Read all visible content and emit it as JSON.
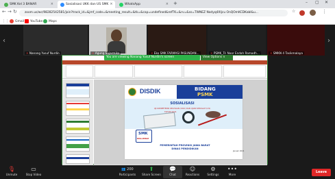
{
  "browser": {
    "tabs": [
      {
        "title": "SMK Kel 3 BANAR",
        "color": "#4caf50"
      },
      {
        "title": "Sosialisasi UKK dan US SMK",
        "color": "#2d8cff"
      },
      {
        "title": "WhatsApp",
        "color": "#25d366"
      }
    ],
    "url": "zoom.us/wc/98282542581/join?track_id=&jmf_code=&meeting_result=&tk=&cap=undefined&refTK=&rv=&ss=TWNEZ Nodyq4XIjcu OnQOmKCDKabl&u...",
    "bookmarks": [
      {
        "label": "Gmail",
        "color": "#ea4335"
      },
      {
        "label": "YouTube",
        "color": "#ff0000"
      },
      {
        "label": "Maps",
        "color": "#34a853"
      }
    ]
  },
  "participants": [
    {
      "name": "Nanang Yusuf Nurdin",
      "bg": "#2b2b2b"
    },
    {
      "name": "Agung Sujarmiko",
      "bg": "#cfcfcf"
    },
    {
      "name": "Eko SMK FARMASI PASUNDAN...",
      "bg": "#2a1a14"
    },
    {
      "name": "PSMK_Tri Noor Endah Ramadh...",
      "bg": "#202020"
    },
    {
      "name": "SMKN 4 Tasikmalaya",
      "bg": "#3a0c0c"
    }
  ],
  "share": {
    "banner": "You are viewing Nanang Yusuf Nurdin's screen",
    "view_options": "View Options ∨"
  },
  "slide": {
    "logo": "DISDIK",
    "bidang_line1": "BIDANG",
    "bidang_line2": "PSMK",
    "title": "SOSIALISASI",
    "subtitle": "UJI KOMPETENSI KEAHLIAN (UKK) DAN UJIAN SEKOLAH (US)",
    "year": "TAHUN 2021",
    "badge_line1": "SMK",
    "badge_line2": "BISA-HEBAT",
    "footer_line1": "PEMERINTAH PROVINSI JAWA BARAT",
    "footer_line2": "DINAS PENDIDIKAN",
    "date": "Januari 2021"
  },
  "toolbar": {
    "unmute": "Unmute",
    "stop_video": "Stop Video",
    "participants": "Participants",
    "participants_count": "200",
    "share_screen": "Share Screen",
    "chat": "Chat",
    "reactions": "Reactions",
    "settings": "Settings",
    "more": "More",
    "leave": "Leave"
  },
  "colors": {
    "share_green": "#2eb34a",
    "leave_red": "#e02828",
    "ppt_red": "#b7472a",
    "slide_blue": "#1a3f9a"
  }
}
